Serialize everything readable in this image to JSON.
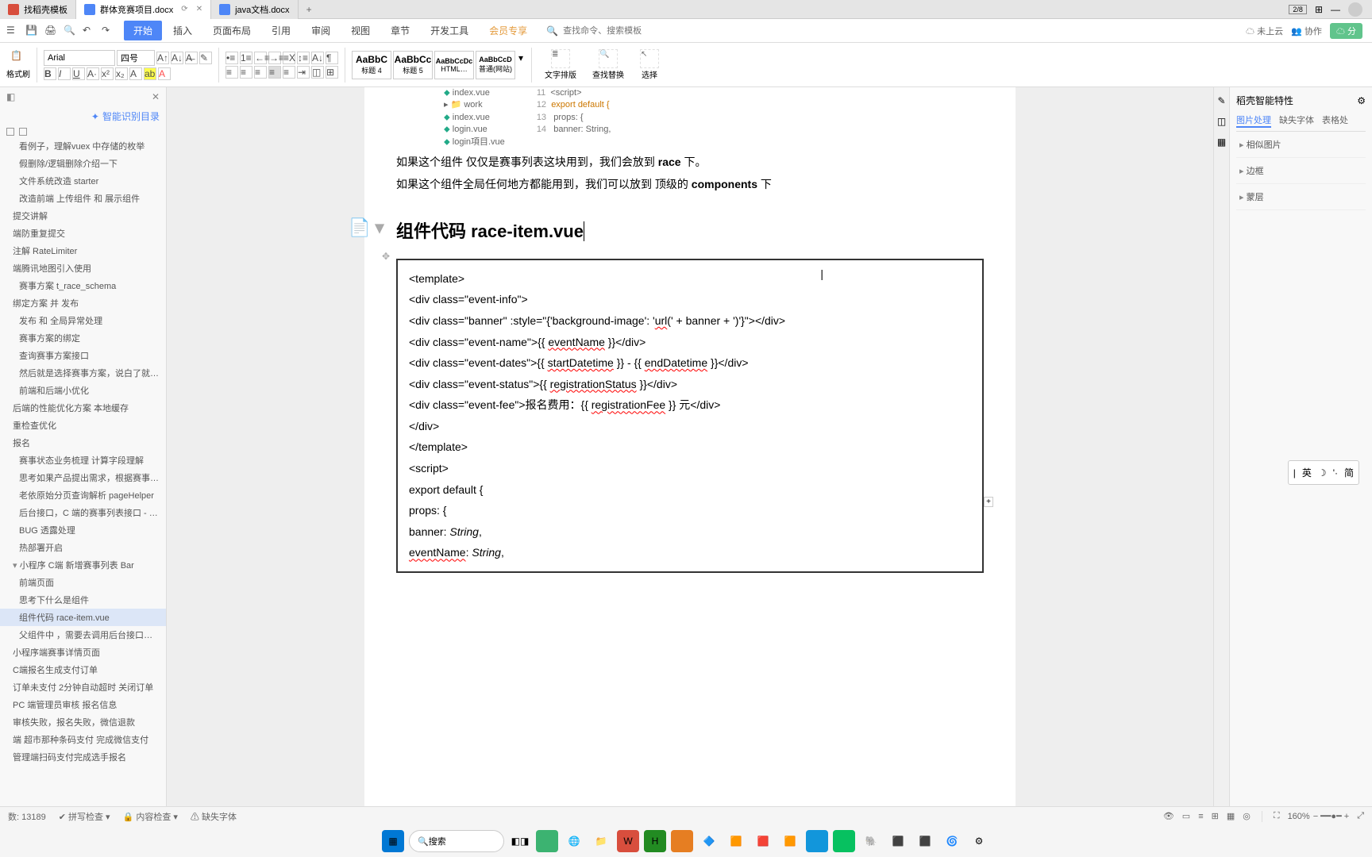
{
  "tabs": {
    "first": "找稻壳模板",
    "second": "群体竞赛项目.docx",
    "third": "java文档.docx"
  },
  "tabbar_right": {
    "grid": "⊞",
    "menu": "☰"
  },
  "menu": {
    "items": [
      "开始",
      "插入",
      "页面布局",
      "引用",
      "审阅",
      "视图",
      "章节",
      "开发工具",
      "会员专享"
    ],
    "search_placeholder": "查找命令、搜索模板",
    "cloud": "未上云",
    "collab": "协作",
    "share": "☁ 分"
  },
  "ribbon": {
    "paste": "粘贴",
    "format": "格式刷",
    "font": "Arial",
    "size": "四号",
    "styles": [
      {
        "preview": "AaBbC",
        "name": "标题 4"
      },
      {
        "preview": "AaBbCc",
        "name": "标题 5"
      },
      {
        "preview": "AaBbCcDc",
        "name": "HTML…"
      },
      {
        "preview": "AaBbCcD",
        "name": "普通(网站)"
      }
    ],
    "arrange": "文字排版",
    "find": "查找替换",
    "select": "选择"
  },
  "outline": {
    "header": "智能识别目录",
    "items": [
      {
        "t": "看例子，理解vuex 中存储的枚举",
        "lv": 1
      },
      {
        "t": "假删除/逻辑删除介绍一下",
        "lv": 1
      },
      {
        "t": "文件系统改造 starter",
        "lv": 1
      },
      {
        "t": "改造前端 上传组件 和 展示组件",
        "lv": 1
      },
      {
        "t": "提交讲解",
        "lv": 0
      },
      {
        "t": "端防重复提交",
        "lv": 0
      },
      {
        "t": "注解 RateLimiter",
        "lv": 0
      },
      {
        "t": "端腾讯地图引入使用",
        "lv": 0
      },
      {
        "t": "赛事方案 t_race_schema",
        "lv": 1
      },
      {
        "t": "绑定方案 并 发布",
        "lv": 0
      },
      {
        "t": "发布 和 全局异常处理",
        "lv": 1
      },
      {
        "t": "赛事方案的绑定",
        "lv": 1
      },
      {
        "t": "查询赛事方案接口",
        "lv": 1
      },
      {
        "t": "然后就是选择赛事方案，说白了就是 upd…",
        "lv": 1
      },
      {
        "t": "前端和后端小优化",
        "lv": 1
      },
      {
        "t": "后端的性能优化方案 本地缓存",
        "lv": 0
      },
      {
        "t": "重检查优化",
        "lv": 0
      },
      {
        "t": "报名",
        "lv": 0
      },
      {
        "t": "赛事状态业务梳理 计算字段理解",
        "lv": 1
      },
      {
        "t": "思考如果产品提出需求，根据赛事状态…",
        "lv": 1
      },
      {
        "t": "老依原始分页查询解析 pageHelper",
        "lv": 1
      },
      {
        "t": "后台接口，C 端的赛事列表接口 - 假分…",
        "lv": 1
      },
      {
        "t": "BUG 透露处理",
        "lv": 1
      },
      {
        "t": "热部署开启",
        "lv": 1
      },
      {
        "t": "小程序 C端 新增赛事列表 Bar",
        "lv": 0,
        "exp": true
      },
      {
        "t": "前端页面",
        "lv": 1
      },
      {
        "t": "思考下什么是组件",
        "lv": 1
      },
      {
        "t": "组件代码 race-item.vue",
        "lv": 1,
        "sel": true
      },
      {
        "t": "父组件中 ，需要去调用后台接口，…",
        "lv": 1
      },
      {
        "t": "小程序端赛事详情页面",
        "lv": 0
      },
      {
        "t": "C端报名生成支付订单",
        "lv": 0
      },
      {
        "t": "订单未支付 2分钟自动超时 关闭订单",
        "lv": 0
      },
      {
        "t": "PC 端管理员审核 报名信息",
        "lv": 0
      },
      {
        "t": "审核失败，报名失败，微信退款",
        "lv": 0
      },
      {
        "t": "端 超市那种条码支付 完成微信支付",
        "lv": 0
      },
      {
        "t": "管理端扫码支付完成选手报名",
        "lv": 0
      }
    ]
  },
  "doc": {
    "topcode": {
      "lines": [
        "index.vue",
        "work",
        "index.vue",
        "login.vue",
        "login項目.vue"
      ],
      "right": [
        "<script>",
        "export default {",
        "  props: {",
        "    banner: String,"
      ]
    },
    "para1_a": "如果这个组件 仅仅是赛事列表这块用到，我们会放到 ",
    "para1_b": "race",
    "para1_c": " 下。",
    "para2_a": "如果这个组件全局任何地方都能用到，我们可以放到 顶级的 ",
    "para2_b": "components",
    "para2_c": " 下",
    "h1": "组件代码 race-item.vue",
    "code": {
      "l1": "<template>",
      "l2": "  <div class=\"event-info\">",
      "l3a": "    <div class=\"banner\" :style=\"{'background-image': '",
      "l3b": "url",
      "l3c": "(' + banner + ')'}\"></div>",
      "l4a": "    <div class=\"event-name\">{{ ",
      "l4b": "eventName",
      "l4c": " }}</div>",
      "l5a": "    <div class=\"event-dates\">{{ ",
      "l5b": "startDatetime",
      "l5c": " }} - {{ ",
      "l5d": "endDatetime",
      "l5e": " }}</div>",
      "l6a": "    <div class=\"event-status\">{{ ",
      "l6b": "registrationStatus",
      "l6c": " }}</div>",
      "l7a": "    <div class=\"event-fee\">报名费用：{{ ",
      "l7b": "registrationFee",
      "l7c": " }} 元</div>",
      "l8": "  </div>",
      "l9": "</template>",
      "l10": "",
      "l11": "<script>",
      "l12": "export default {",
      "l13": "  props: {",
      "l14a": "    banner: ",
      "l14b": "String",
      "l14c": ",",
      "l15a": "    ",
      "l15b": "eventName",
      "l15c": ": ",
      "l15d": "String",
      "l15e": ","
    }
  },
  "rightpanel": {
    "title": "稻壳智能特性",
    "tabs": [
      "图片处理",
      "缺失字体",
      "表格处"
    ],
    "items": [
      "相似图片",
      "边框",
      "蒙层"
    ]
  },
  "status": {
    "wordcount": "数: 13189",
    "spell": "拼写检查",
    "inspect": "内容检查",
    "missing": "缺失字体",
    "zoom": "160%"
  },
  "float": {
    "lang": "英"
  },
  "taskbar": {
    "search": "搜索"
  }
}
